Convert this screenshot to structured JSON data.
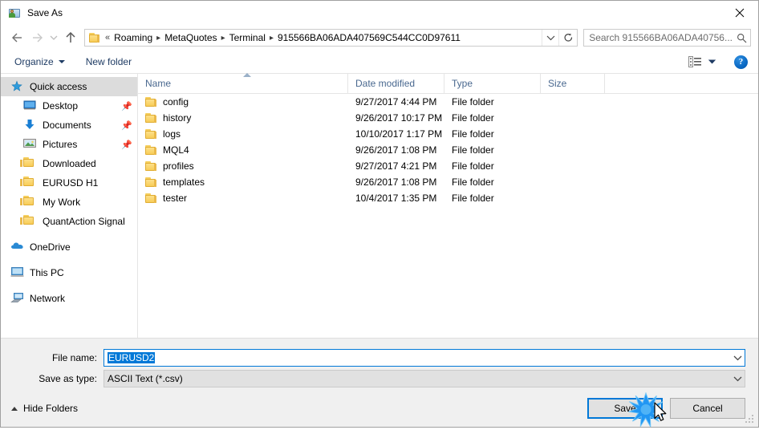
{
  "window": {
    "title": "Save As",
    "icon": "save-as-window-icon",
    "close_label": "✕"
  },
  "nav": {
    "back_icon": "arrow-left-icon",
    "forward_icon": "arrow-right-icon",
    "recent_icon": "chevron-down-icon",
    "up_icon": "arrow-up-icon",
    "refresh_icon": "refresh-icon",
    "address_dropdown_icon": "chevron-down-icon",
    "address_folder_icon": "folder-icon",
    "overflow_marker": "«",
    "breadcrumbs": [
      "Roaming",
      "MetaQuotes",
      "Terminal",
      "915566BA06ADA407569C544CC0D97611"
    ]
  },
  "search": {
    "placeholder": "Search 915566BA06ADA40756...",
    "icon": "search-icon"
  },
  "toolbar": {
    "organize_label": "Organize",
    "new_folder_label": "New folder",
    "view_icon": "details-view-icon",
    "view_dropdown_icon": "chevron-down-icon",
    "help_label": "?",
    "help_icon": "help-icon"
  },
  "sidebar": {
    "items": [
      {
        "label": "Quick access",
        "icon": "star-icon",
        "level": 0,
        "selected": true,
        "pin": ""
      },
      {
        "label": "Desktop",
        "icon": "monitor-icon",
        "level": 1,
        "selected": false,
        "pin": "📌"
      },
      {
        "label": "Documents",
        "icon": "download-arrow-icon",
        "level": 1,
        "selected": false,
        "pin": "📌"
      },
      {
        "label": "Pictures",
        "icon": "picture-icon",
        "level": 1,
        "selected": false,
        "pin": "📌"
      },
      {
        "label": "Downloaded",
        "icon": "folder-icon",
        "level": 1,
        "selected": false,
        "pin": ""
      },
      {
        "label": "EURUSD H1",
        "icon": "folder-icon",
        "level": 1,
        "selected": false,
        "pin": ""
      },
      {
        "label": "My Work",
        "icon": "folder-icon",
        "level": 1,
        "selected": false,
        "pin": ""
      },
      {
        "label": "QuantAction Signal",
        "icon": "folder-icon",
        "level": 1,
        "selected": false,
        "pin": ""
      },
      {
        "label": "OneDrive",
        "icon": "cloud-icon",
        "level": 0,
        "selected": false,
        "pin": ""
      },
      {
        "label": "This PC",
        "icon": "computer-icon",
        "level": 0,
        "selected": false,
        "pin": ""
      },
      {
        "label": "Network",
        "icon": "network-icon",
        "level": 0,
        "selected": false,
        "pin": ""
      }
    ]
  },
  "filelist": {
    "columns": {
      "name": "Name",
      "date": "Date modified",
      "type": "Type",
      "size": "Size"
    },
    "sort_column": "Name",
    "sort_direction": "ascending",
    "rows": [
      {
        "name": "config",
        "date": "9/27/2017 4:44 PM",
        "type": "File folder",
        "size": ""
      },
      {
        "name": "history",
        "date": "9/26/2017 10:17 PM",
        "type": "File folder",
        "size": ""
      },
      {
        "name": "logs",
        "date": "10/10/2017 1:17 PM",
        "type": "File folder",
        "size": ""
      },
      {
        "name": "MQL4",
        "date": "9/26/2017 1:08 PM",
        "type": "File folder",
        "size": ""
      },
      {
        "name": "profiles",
        "date": "9/27/2017 4:21 PM",
        "type": "File folder",
        "size": ""
      },
      {
        "name": "templates",
        "date": "9/26/2017 1:08 PM",
        "type": "File folder",
        "size": ""
      },
      {
        "name": "tester",
        "date": "10/4/2017 1:35 PM",
        "type": "File folder",
        "size": ""
      }
    ]
  },
  "form": {
    "filename_label": "File name:",
    "filename_value": "EURUSD2",
    "filename_selected": true,
    "filetype_label": "Save as type:",
    "filetype_value": "ASCII Text (*.csv)",
    "dropdown_icon": "chevron-down-icon"
  },
  "footer": {
    "hide_folders_label": "Hide Folders",
    "hide_folders_icon": "chevron-up-icon",
    "save_label": "Save",
    "cancel_label": "Cancel",
    "resize_grip_icon": "resize-grip-icon",
    "cursor_icon": "mouse-pointer-icon",
    "click_effect_icon": "click-burst-icon"
  },
  "colors": {
    "accent": "#0078d7",
    "column_header_text": "#49688f",
    "toolbar_text": "#1f3c64",
    "folder_yellow": "#f8cd59",
    "panel_bg": "#f0f0f0"
  }
}
